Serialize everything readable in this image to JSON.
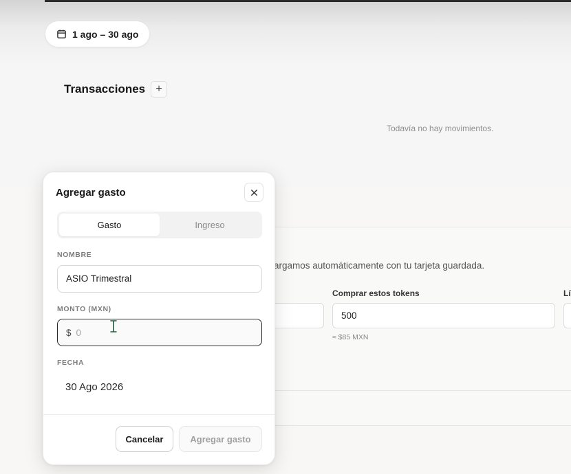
{
  "header": {
    "date_range": "1 ago – 30 ago"
  },
  "transactions": {
    "title": "Transacciones",
    "add_label": "+",
    "empty_text": "Todavía no hay movimientos."
  },
  "background_card": {
    "description_partial": "argamos automáticamente con tu tarjeta guardada.",
    "tokens_label": "Comprar estos tokens",
    "tokens_value": "500",
    "tokens_hint": "≈ $85 MXN",
    "limit_label_partial": "Lí"
  },
  "modal": {
    "title": "Agregar gasto",
    "tabs": [
      {
        "label": "Gasto",
        "active": true
      },
      {
        "label": "Ingreso",
        "active": false
      }
    ],
    "name_label": "NOMBRE",
    "name_value": "ASIO Trimestral",
    "amount_label": "MONTO (MXN)",
    "amount_currency": "$",
    "amount_placeholder": "0",
    "date_label": "FECHA",
    "date_value": "30 Ago 2026",
    "cancel_label": "Cancelar",
    "submit_label": "Agregar gasto"
  },
  "icons": {
    "calendar": "calendar-icon",
    "close": "close-icon",
    "text_cursor": "ibeam-cursor-icon"
  }
}
